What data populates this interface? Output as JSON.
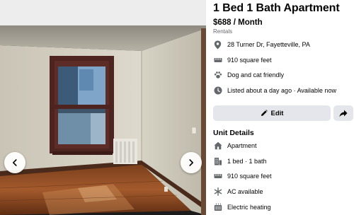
{
  "listing": {
    "title": "1 Bed 1 Bath Apartment",
    "price": "$688 / Month",
    "category": "Rentals"
  },
  "info": [
    {
      "icon": "location-pin-icon",
      "text": "28 Turner Dr, Fayetteville, PA"
    },
    {
      "icon": "ruler-icon",
      "text": "910 square feet"
    },
    {
      "icon": "paw-icon",
      "text": "Dog and cat friendly"
    },
    {
      "icon": "clock-icon",
      "text": "Listed about a day ago · Available now"
    }
  ],
  "actions": {
    "edit_label": "Edit"
  },
  "unit_details": {
    "title": "Unit Details",
    "items": [
      {
        "icon": "home-icon",
        "text": "Apartment"
      },
      {
        "icon": "building-icon",
        "text": "1 bed · 1 bath"
      },
      {
        "icon": "ruler-icon",
        "text": "910 square feet"
      },
      {
        "icon": "snowflake-icon",
        "text": "AC available"
      },
      {
        "icon": "heater-icon",
        "text": "Electric heating"
      }
    ]
  },
  "colors": {
    "icon_gray": "#65676b",
    "button_bg": "#e4e6eb",
    "text": "#050505"
  }
}
